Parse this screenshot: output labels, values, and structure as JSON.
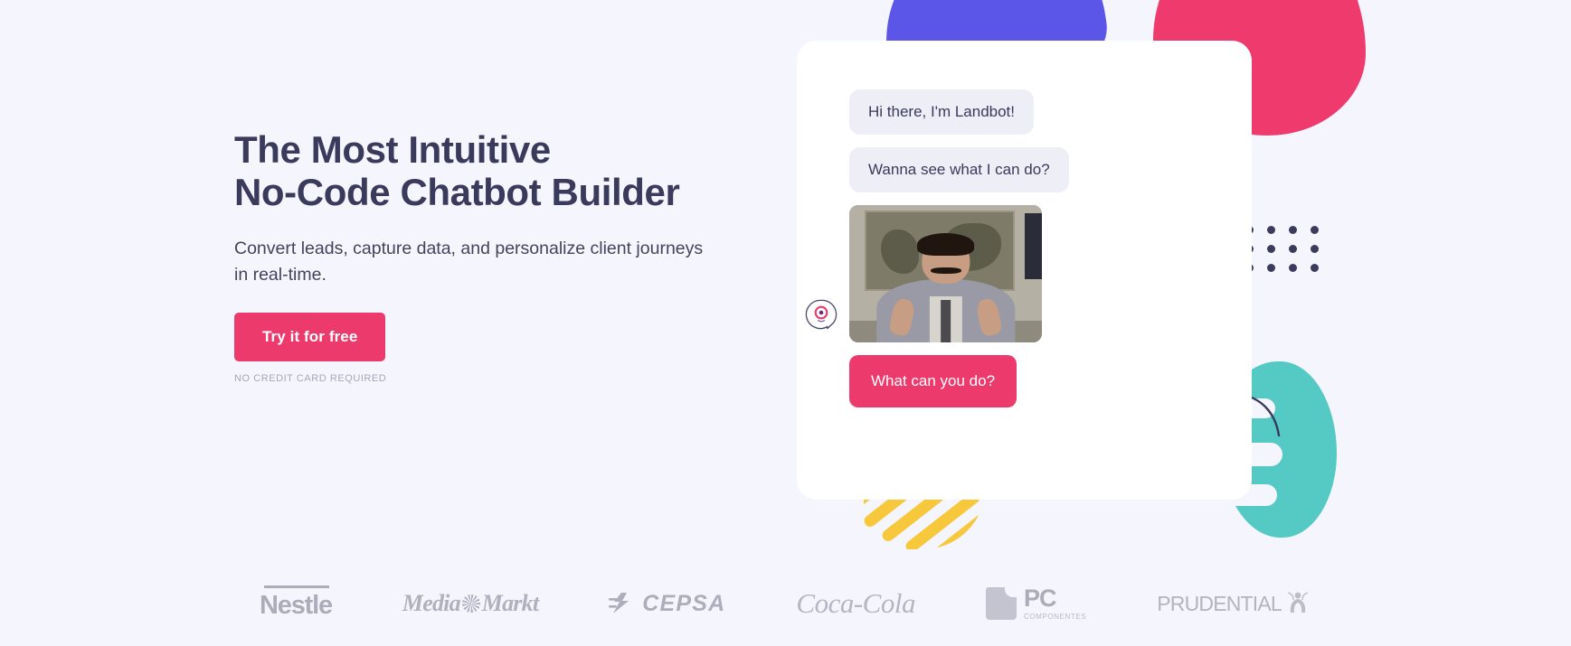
{
  "theme": {
    "background": "#f5f5fd",
    "accent_pink": "#ed3a6d",
    "heading_navy": "#3a3a5c",
    "blob_purple": "#5b55e8",
    "blob_teal": "#55c9c3",
    "stripe_yellow": "#f7c83c",
    "bubble_bot_bg": "#eeeef7",
    "logo_gray": "#b5b5c4"
  },
  "hero": {
    "title": "The Most Intuitive\nNo-Code Chatbot Builder",
    "subtitle": "Convert leads, capture data, and personalize client journeys in real-time.",
    "cta_label": "Try it for free",
    "cta_note": "NO CREDIT CARD REQUIRED"
  },
  "chat": {
    "avatar_icon": "landbot-avatar-icon",
    "messages": [
      {
        "from": "bot",
        "type": "text",
        "text": "Hi there, I'm Landbot!"
      },
      {
        "from": "bot",
        "type": "text",
        "text": "Wanna see what I can do?"
      },
      {
        "from": "bot",
        "type": "image",
        "alt": "Man in grey suit giving two thumbs up in front of a world map"
      },
      {
        "from": "user",
        "type": "text",
        "text": "What can you do?"
      }
    ]
  },
  "logos": [
    {
      "name": "nestle",
      "label": "Nestle"
    },
    {
      "name": "mediamarkt",
      "label_a": "Media",
      "label_b": "Markt"
    },
    {
      "name": "cepsa",
      "label": "CEPSA"
    },
    {
      "name": "coca-cola",
      "label": "Coca-Cola"
    },
    {
      "name": "pccomponentes",
      "label": "PC",
      "sublabel": "COMPONENTES"
    },
    {
      "name": "prudential",
      "label": "PRUDENTIAL"
    }
  ]
}
